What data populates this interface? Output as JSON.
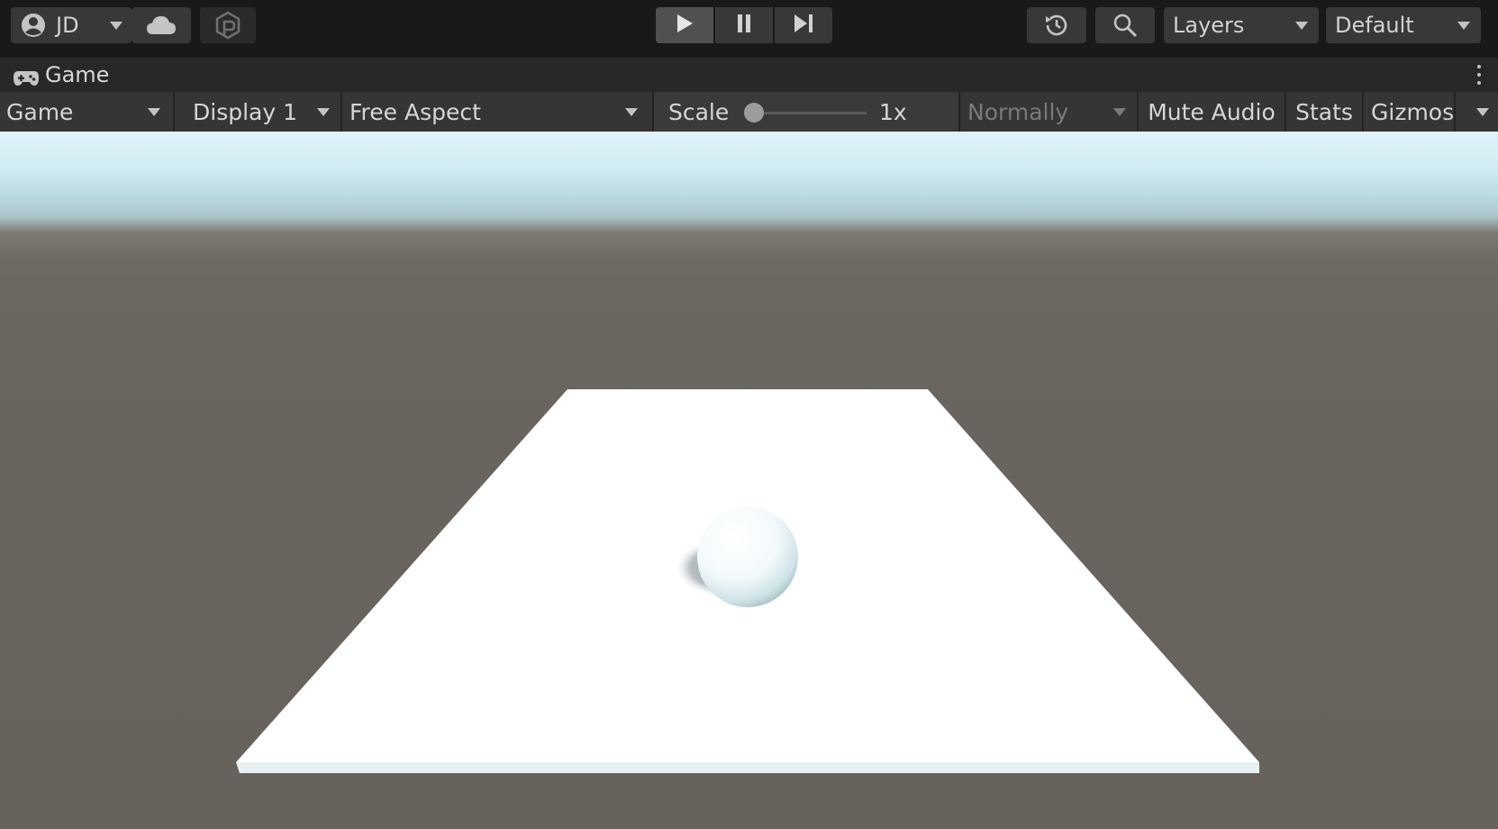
{
  "toolbar": {
    "account_label": "JD",
    "layers_label": "Layers",
    "layout_label": "Default",
    "icons": {
      "account": "account-icon",
      "cloud": "cloud-icon",
      "collab": "collab-icon",
      "play": "play-icon",
      "pause": "pause-icon",
      "step": "step-icon",
      "history": "history-icon",
      "search": "search-icon"
    }
  },
  "tab": {
    "title": "Game",
    "icon": "gamepad-icon"
  },
  "game_toolbar": {
    "view_mode": "Game",
    "display": "Display 1",
    "aspect": "Free Aspect",
    "scale_label": "Scale",
    "scale_value": "1x",
    "scale_level": 0,
    "play_mode": "Normally",
    "mute_audio": "Mute Audio",
    "stats": "Stats",
    "gizmos": "Gizmos"
  },
  "scene": {
    "sky_color": "#d8eff6",
    "ground_color": "#68635c",
    "plane_color": "#ffffff",
    "sphere_color": "#ffffff",
    "shadow_color": "#c9d0d3"
  }
}
